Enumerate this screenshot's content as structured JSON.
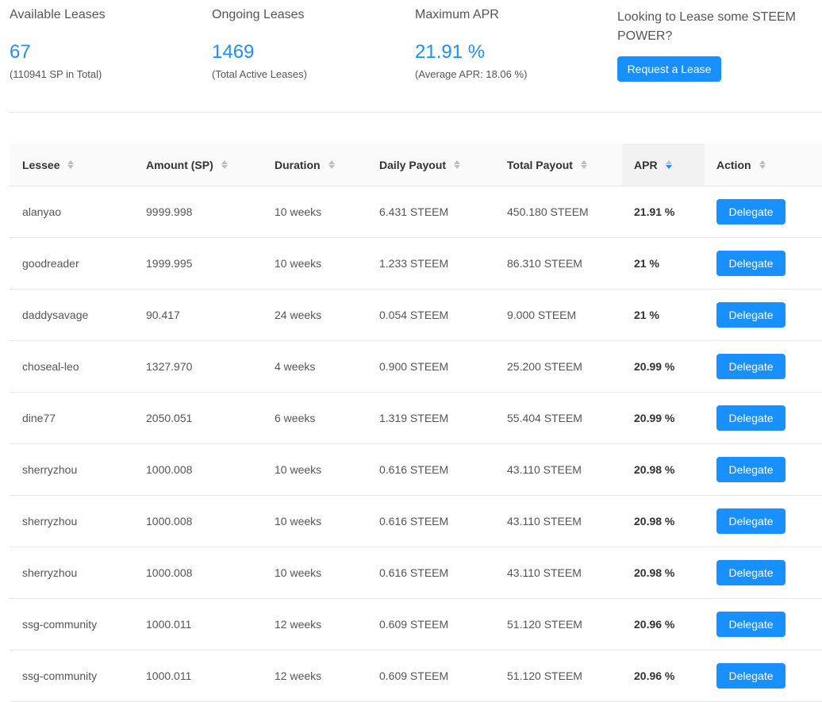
{
  "stats": [
    {
      "title": "Available Leases",
      "value": "67",
      "sub": "(110941 SP in Total)"
    },
    {
      "title": "Ongoing Leases",
      "value": "1469",
      "sub": "(Total Active Leases)"
    },
    {
      "title": "Maximum APR",
      "value": "21.91 %",
      "sub": "(Average APR: 18.06 %)"
    }
  ],
  "cta": {
    "title": "Looking to Lease some STEEM POWER?",
    "button_label": "Request a Lease"
  },
  "table": {
    "columns": [
      "Lessee",
      "Amount (SP)",
      "Duration",
      "Daily Payout",
      "Total Payout",
      "APR",
      "Action"
    ],
    "sorted_column": "APR",
    "sort_direction": "descending",
    "accent_color": "#1890ff",
    "rows": [
      {
        "lessee": "alanyao",
        "amount": "9999.998",
        "duration": "10 weeks",
        "daily": "6.431 STEEM",
        "total": "450.180 STEEM",
        "apr": "21.91 %",
        "action": "Delegate"
      },
      {
        "lessee": "goodreader",
        "amount": "1999.995",
        "duration": "10 weeks",
        "daily": "1.233 STEEM",
        "total": "86.310 STEEM",
        "apr": "21 %",
        "action": "Delegate"
      },
      {
        "lessee": "daddysavage",
        "amount": "90.417",
        "duration": "24 weeks",
        "daily": "0.054 STEEM",
        "total": "9.000 STEEM",
        "apr": "21 %",
        "action": "Delegate"
      },
      {
        "lessee": "choseal-leo",
        "amount": "1327.970",
        "duration": "4 weeks",
        "daily": "0.900 STEEM",
        "total": "25.200 STEEM",
        "apr": "20.99 %",
        "action": "Delegate"
      },
      {
        "lessee": "dine77",
        "amount": "2050.051",
        "duration": "6 weeks",
        "daily": "1.319 STEEM",
        "total": "55.404 STEEM",
        "apr": "20.99 %",
        "action": "Delegate"
      },
      {
        "lessee": "sherryzhou",
        "amount": "1000.008",
        "duration": "10 weeks",
        "daily": "0.616 STEEM",
        "total": "43.110 STEEM",
        "apr": "20.98 %",
        "action": "Delegate"
      },
      {
        "lessee": "sherryzhou",
        "amount": "1000.008",
        "duration": "10 weeks",
        "daily": "0.616 STEEM",
        "total": "43.110 STEEM",
        "apr": "20.98 %",
        "action": "Delegate"
      },
      {
        "lessee": "sherryzhou",
        "amount": "1000.008",
        "duration": "10 weeks",
        "daily": "0.616 STEEM",
        "total": "43.110 STEEM",
        "apr": "20.98 %",
        "action": "Delegate"
      },
      {
        "lessee": "ssg-community",
        "amount": "1000.011",
        "duration": "12 weeks",
        "daily": "0.609 STEEM",
        "total": "51.120 STEEM",
        "apr": "20.96 %",
        "action": "Delegate"
      },
      {
        "lessee": "ssg-community",
        "amount": "1000.011",
        "duration": "12 weeks",
        "daily": "0.609 STEEM",
        "total": "51.120 STEEM",
        "apr": "20.96 %",
        "action": "Delegate"
      }
    ]
  }
}
